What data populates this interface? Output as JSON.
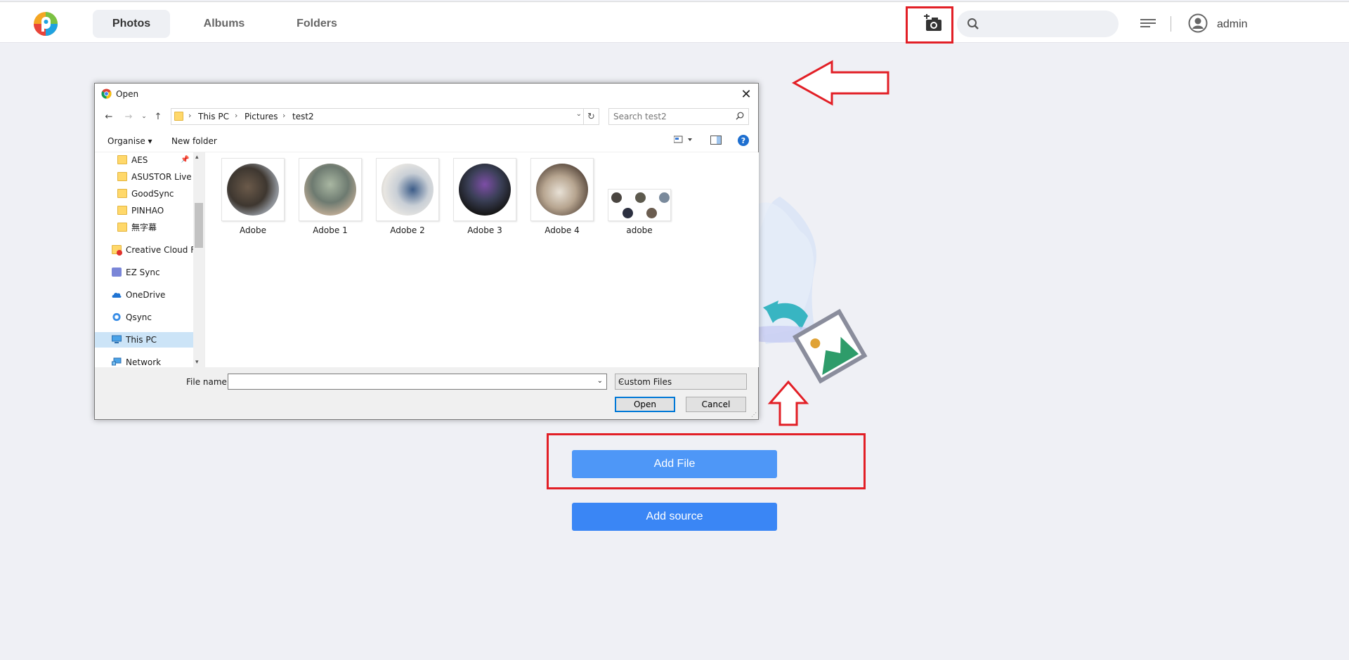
{
  "topbar": {
    "tabs": [
      {
        "label": "Photos",
        "active": true
      },
      {
        "label": "Albums",
        "active": false
      },
      {
        "label": "Folders",
        "active": false
      }
    ],
    "search_placeholder": "",
    "user_name": "admin"
  },
  "main": {
    "add_file_label": "Add File",
    "add_source_label": "Add source"
  },
  "dialog": {
    "title": "Open",
    "breadcrumb": [
      "This PC",
      "Pictures",
      "test2"
    ],
    "search_placeholder": "Search test2",
    "commands": {
      "organise": "Organise",
      "new_folder": "New folder"
    },
    "nav_items": [
      {
        "label": "AES",
        "icon": "folder-icon"
      },
      {
        "label": "ASUSTOR Live Al",
        "icon": "folder-icon"
      },
      {
        "label": "GoodSync",
        "icon": "folder-icon"
      },
      {
        "label": "PINHAO",
        "icon": "folder-icon"
      },
      {
        "label": "無字幕",
        "icon": "folder-icon"
      },
      {
        "label": "Creative Cloud Fil",
        "icon": "creative-cloud-icon"
      },
      {
        "label": "EZ Sync",
        "icon": "ez-sync-icon"
      },
      {
        "label": "OneDrive",
        "icon": "onedrive-icon"
      },
      {
        "label": "Qsync",
        "icon": "qsync-icon"
      },
      {
        "label": "This PC",
        "icon": "this-pc-icon",
        "selected": true
      },
      {
        "label": "Network",
        "icon": "network-icon"
      }
    ],
    "files": [
      {
        "label": "Adobe"
      },
      {
        "label": "Adobe 1"
      },
      {
        "label": "Adobe 2"
      },
      {
        "label": "Adobe 3"
      },
      {
        "label": "Adobe 4"
      },
      {
        "label": "adobe"
      }
    ],
    "file_name_label": "File name:",
    "file_name_value": "",
    "file_type": "Custom Files",
    "open_label": "Open",
    "cancel_label": "Cancel"
  },
  "colors": {
    "accent": "#4e97f7",
    "annotation": "#e21f26",
    "background": "#eff0f5"
  }
}
